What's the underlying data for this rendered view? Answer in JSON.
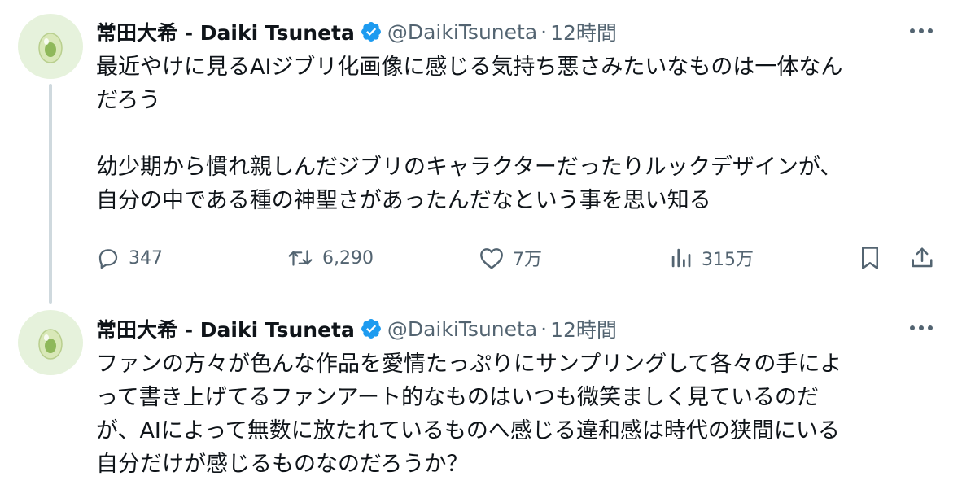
{
  "tweets": [
    {
      "author": {
        "display_name": "常田大希 - Daiki Tsuneta",
        "handle": "@DaikiTsuneta",
        "verified": true
      },
      "separator": "·",
      "time": "12時間",
      "text": "最近やけに見るAIジブリ化画像に感じる気持ち悪さみたいなものは一体なん\nだろう\n\n幼少期から慣れ親しんだジブリのキャラクターだったりルックデザインが、\n自分の中である種の神聖さがあったんだなという事を思い知る",
      "stats": {
        "replies": "347",
        "retweets": "6,290",
        "likes": "7万",
        "views": "315万"
      }
    },
    {
      "author": {
        "display_name": "常田大希 - Daiki Tsuneta",
        "handle": "@DaikiTsuneta",
        "verified": true
      },
      "separator": "·",
      "time": "12時間",
      "text": "ファンの方々が色んな作品を愛情たっぷりにサンプリングして各々の手によ\nって書き上げてるファンアート的なものはいつも微笑ましく見ているのだ\nが、AIによって無数に放たれているものへ感じる違和感は時代の狭間にいる\n自分だけが感じるものなのだろうか？"
    }
  ],
  "icons": {
    "reply": "speech-bubble-icon",
    "retweet": "retweet-arrows-icon",
    "like": "heart-icon",
    "views": "bar-chart-icon",
    "bookmark": "bookmark-icon",
    "share": "upload-icon",
    "more": "more-dots-icon",
    "verified": "verified-badge-icon"
  },
  "colors": {
    "text": "#0f1419",
    "secondary": "#536471",
    "verified": "#1d9bf0",
    "thread_line": "#cfd9de",
    "avatar_bg": "#e6f2dc"
  }
}
